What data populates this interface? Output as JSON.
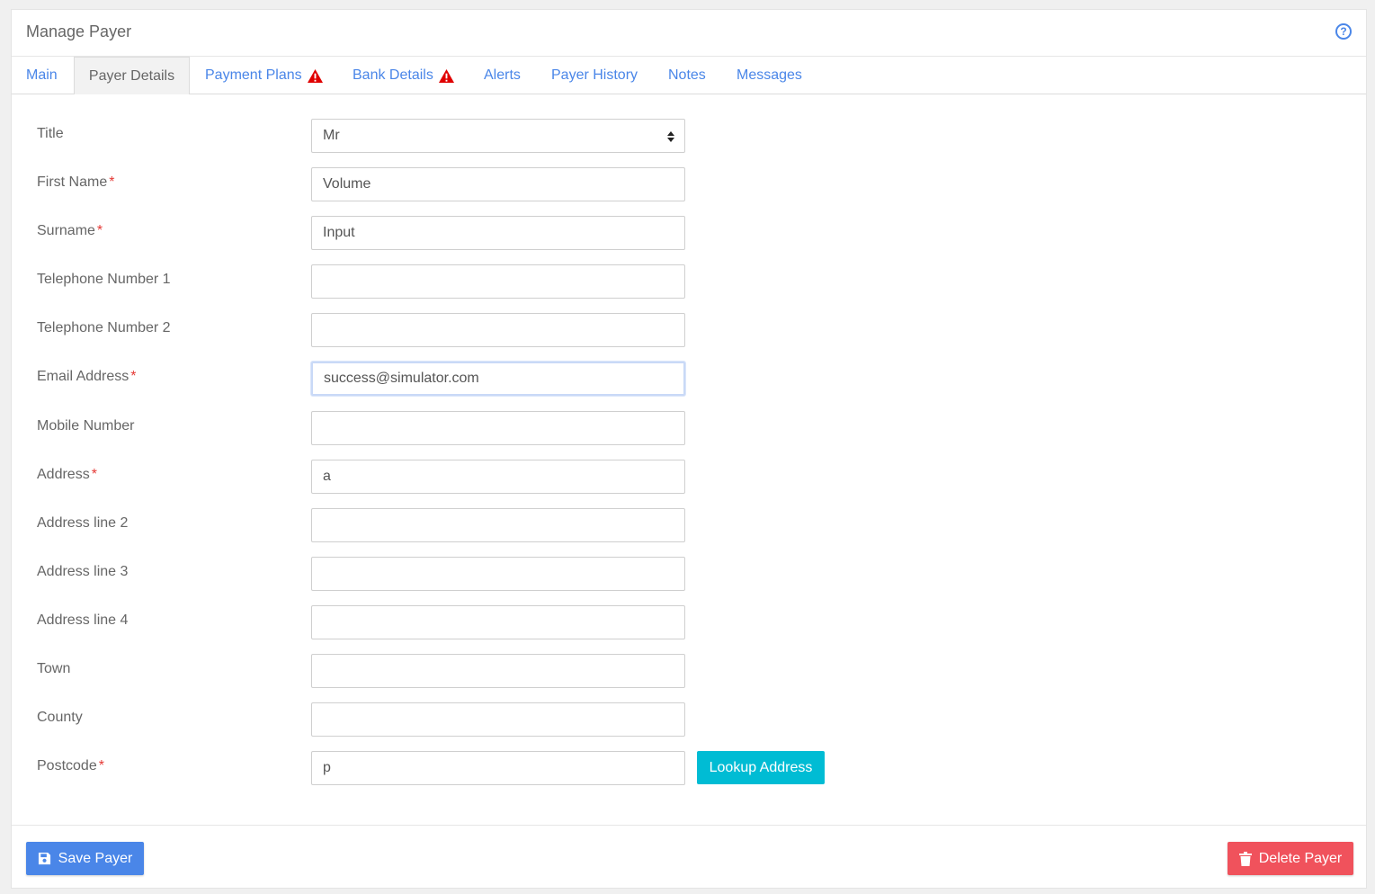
{
  "header": {
    "title": "Manage Payer",
    "help_icon": "?"
  },
  "tabs": [
    {
      "label": "Main",
      "warning": false
    },
    {
      "label": "Payer Details",
      "warning": false,
      "active": true
    },
    {
      "label": "Payment Plans",
      "warning": true
    },
    {
      "label": "Bank Details",
      "warning": true
    },
    {
      "label": "Alerts",
      "warning": false
    },
    {
      "label": "Payer History",
      "warning": false
    },
    {
      "label": "Notes",
      "warning": false
    },
    {
      "label": "Messages",
      "warning": false
    }
  ],
  "form": {
    "title": {
      "label": "Title",
      "value": "Mr",
      "required": false
    },
    "first_name": {
      "label": "First Name",
      "value": "Volume",
      "required": true
    },
    "surname": {
      "label": "Surname",
      "value": "Input",
      "required": true
    },
    "telephone1": {
      "label": "Telephone Number 1",
      "value": "",
      "required": false
    },
    "telephone2": {
      "label": "Telephone Number 2",
      "value": "",
      "required": false
    },
    "email": {
      "label": "Email Address",
      "value": "success@simulator.com",
      "required": true
    },
    "mobile": {
      "label": "Mobile Number",
      "value": "",
      "required": false
    },
    "address": {
      "label": "Address",
      "value": "a",
      "required": true
    },
    "address2": {
      "label": "Address line 2",
      "value": "",
      "required": false
    },
    "address3": {
      "label": "Address line 3",
      "value": "",
      "required": false
    },
    "address4": {
      "label": "Address line 4",
      "value": "",
      "required": false
    },
    "town": {
      "label": "Town",
      "value": "",
      "required": false
    },
    "county": {
      "label": "County",
      "value": "",
      "required": false
    },
    "postcode": {
      "label": "Postcode",
      "value": "p",
      "required": true
    },
    "required_mark": "*"
  },
  "buttons": {
    "lookup": "Lookup Address",
    "save": "Save Payer",
    "delete": "Delete Payer"
  },
  "colors": {
    "link": "#4a86e8",
    "lookup": "#00bcd4",
    "save": "#4a86e8",
    "delete": "#f0525c",
    "required": "#e53935",
    "warning": "#e00000"
  }
}
